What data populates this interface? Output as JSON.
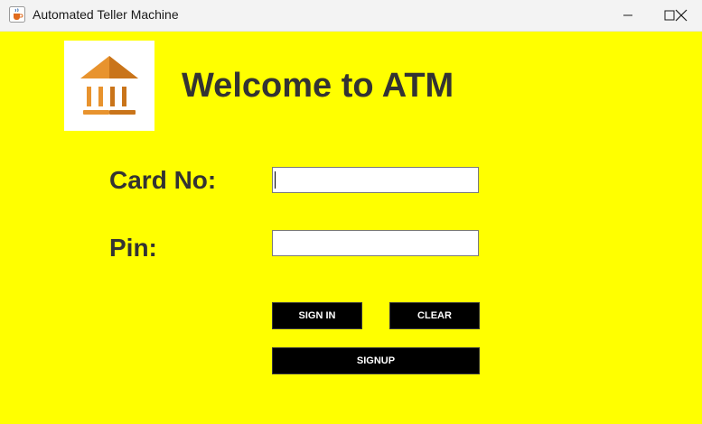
{
  "window": {
    "title": "Automated Teller Machine",
    "icon": "java-cup-icon",
    "controls": {
      "minimize": "minimize-icon",
      "maximize": "maximize-icon",
      "close": "close-icon"
    }
  },
  "main": {
    "logo_icon": "bank-icon",
    "heading": "Welcome to ATM",
    "card_label": "Card No:",
    "pin_label": "Pin:",
    "card_value": "",
    "pin_value": "",
    "buttons": {
      "sign_in": "SIGN IN",
      "clear": "CLEAR",
      "sign_up": "SIGNUP"
    }
  },
  "colors": {
    "background": "#ffff00",
    "text": "#333333",
    "button": "#000000",
    "button_text": "#ffffff",
    "logo_primary": "#e8932e",
    "logo_shade": "#c9741a"
  }
}
